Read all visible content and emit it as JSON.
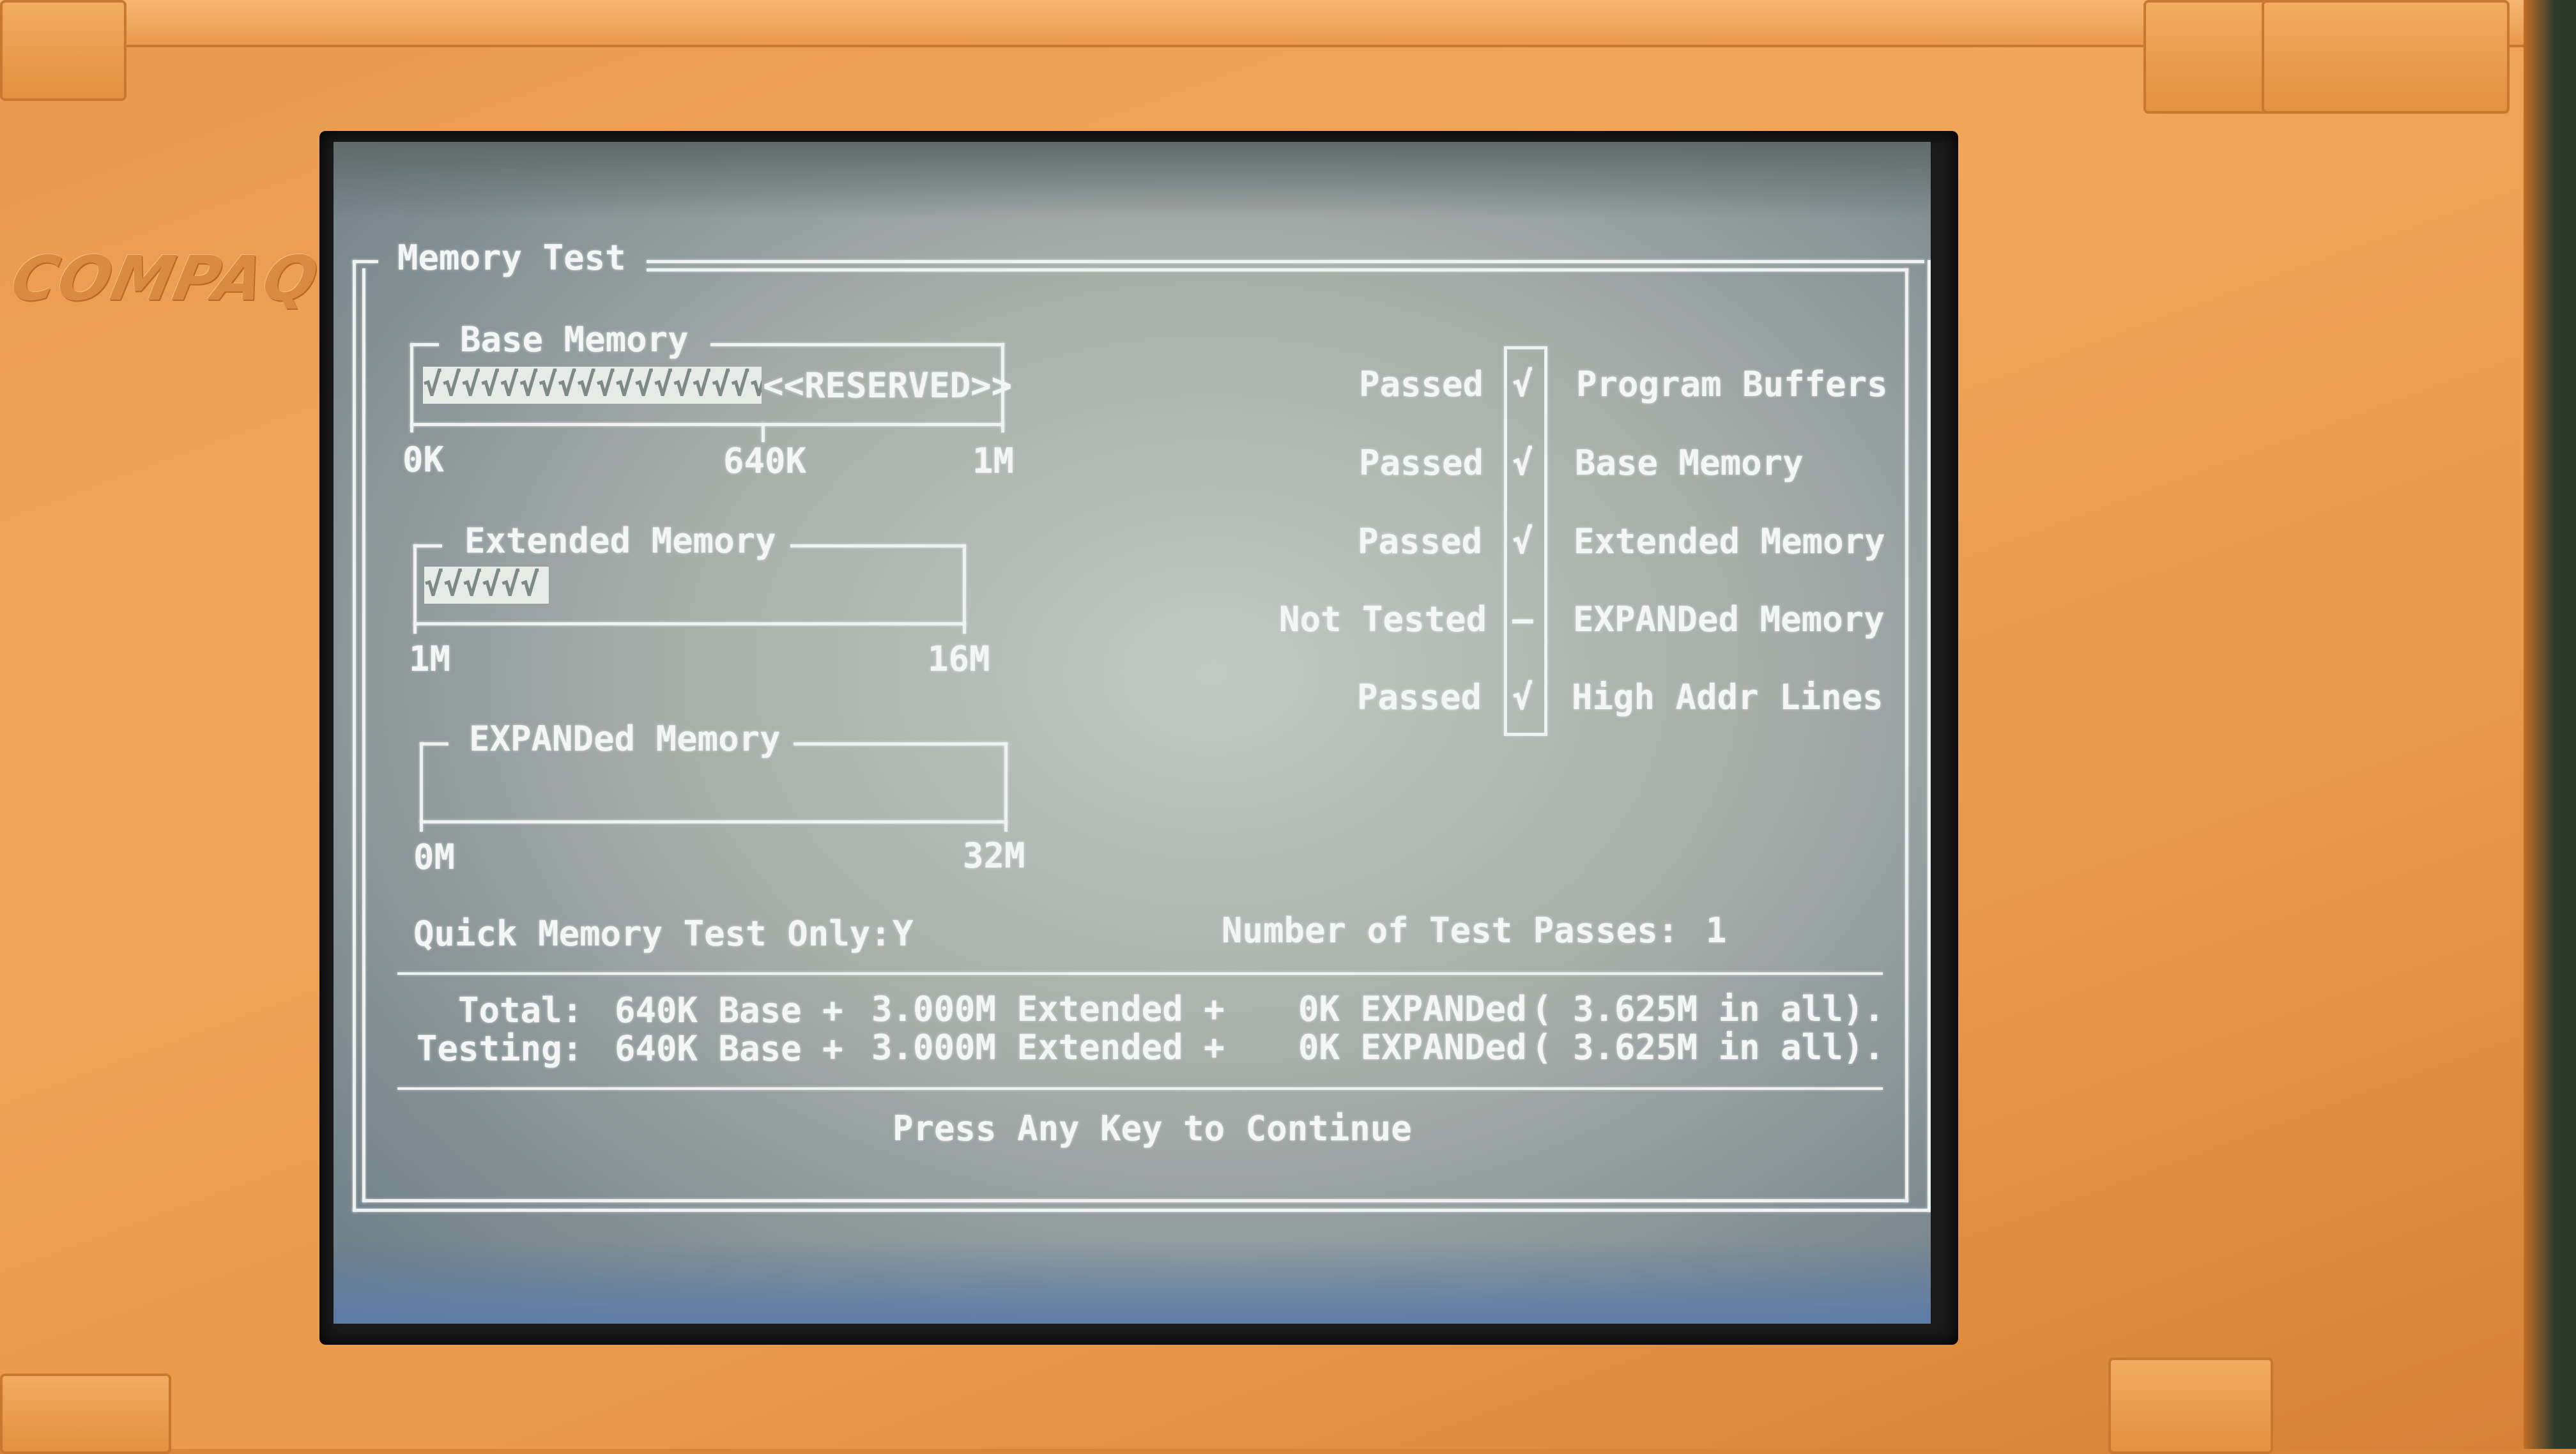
{
  "brand": "COMPAQ",
  "window": {
    "title": "Memory Test"
  },
  "base_memory": {
    "title": "Base Memory",
    "fill_marks": "√√√√√√√√√√√√√√√√√√√√√",
    "reserved_label": "<<RESERVED>>",
    "tick_start": "0K",
    "tick_mid": "640K",
    "tick_end": "1M",
    "tested_fraction": 0.625
  },
  "extended_memory": {
    "title": "Extended Memory",
    "fill_marks": "√√√√√√",
    "tick_start": "1M",
    "tick_end": "16M",
    "tested_fraction": 0.2
  },
  "expanded_memory": {
    "title": "EXPANDed Memory",
    "tick_start": "0M",
    "tick_end": "32M",
    "tested_fraction": 0
  },
  "status_rows": [
    {
      "status": "Passed",
      "mark": "√",
      "name": "Program Buffers"
    },
    {
      "status": "Passed",
      "mark": "√",
      "name": "Base Memory"
    },
    {
      "status": "Passed",
      "mark": "√",
      "name": "Extended Memory"
    },
    {
      "status": "Not Tested",
      "mark": "–",
      "name": "EXPANDed Memory"
    },
    {
      "status": "Passed",
      "mark": "√",
      "name": "High Addr Lines"
    }
  ],
  "quick_test": {
    "label": "Quick Memory Test Only:",
    "value": "Y"
  },
  "test_passes": {
    "label": "Number of Test Passes:",
    "value": "1"
  },
  "summary": {
    "total": {
      "label": "Total:",
      "base": "640K Base +",
      "extended": "3.000M Extended +",
      "expanded": "0K EXPANDed",
      "all": "( 3.625M in all)."
    },
    "testing": {
      "label": "Testing:",
      "base": "640K Base +",
      "extended": "3.000M Extended +",
      "expanded": "0K EXPANDed",
      "all": "( 3.625M in all)."
    }
  },
  "footer": {
    "prompt": "Press Any Key to Continue"
  }
}
